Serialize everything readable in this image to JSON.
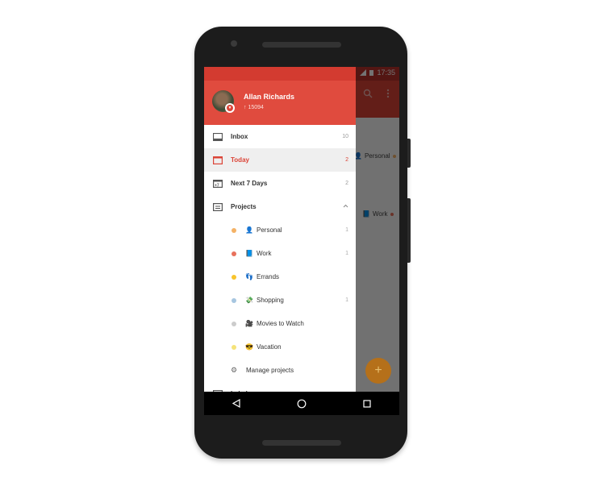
{
  "status_bar": {
    "time": "17:35",
    "signal_icon": "signal-icon",
    "battery_icon": "battery-icon"
  },
  "app_toolbar": {
    "search_icon": "search-icon",
    "menu_icon": "more-vert-icon"
  },
  "background_list": [
    {
      "label": "Personal",
      "emoji": "👤",
      "dot_color": "#f4b266"
    },
    {
      "label": "Work",
      "emoji": "📘",
      "dot_color": "#e8715c"
    }
  ],
  "fab": {
    "label": "+"
  },
  "drawer": {
    "user": {
      "name": "Allan Richards",
      "karma": "↑ 15094"
    },
    "nav": [
      {
        "label": "Inbox",
        "count": "10",
        "icon": "inbox-icon"
      },
      {
        "label": "Today",
        "count": "2",
        "icon": "calendar-today-icon",
        "active": true
      },
      {
        "label": "Next 7 Days",
        "count": "2",
        "icon": "calendar-week-icon"
      },
      {
        "label": "Projects",
        "count": "^",
        "icon": "projects-icon"
      }
    ],
    "projects": [
      {
        "label": "Personal",
        "emoji": "👤",
        "count": "1",
        "dot_color": "#f4b266"
      },
      {
        "label": "Work",
        "emoji": "📘",
        "count": "1",
        "dot_color": "#e8715c"
      },
      {
        "label": "Errands",
        "emoji": "👣",
        "count": "",
        "dot_color": "#f8c42c"
      },
      {
        "label": "Shopping",
        "emoji": "💸",
        "count": "1",
        "dot_color": "#a7c6e0"
      },
      {
        "label": "Movies to Watch",
        "emoji": "🎥",
        "count": "",
        "dot_color": "#cccccc"
      },
      {
        "label": "Vacation",
        "emoji": "😎",
        "count": "",
        "dot_color": "#f5e37a"
      }
    ],
    "manage": {
      "label": "Manage projects",
      "icon": "⚙"
    },
    "next_section": {
      "label": "Labels"
    }
  },
  "nav_bar": {
    "back": "back-icon",
    "home": "home-icon",
    "recents": "recents-icon"
  }
}
